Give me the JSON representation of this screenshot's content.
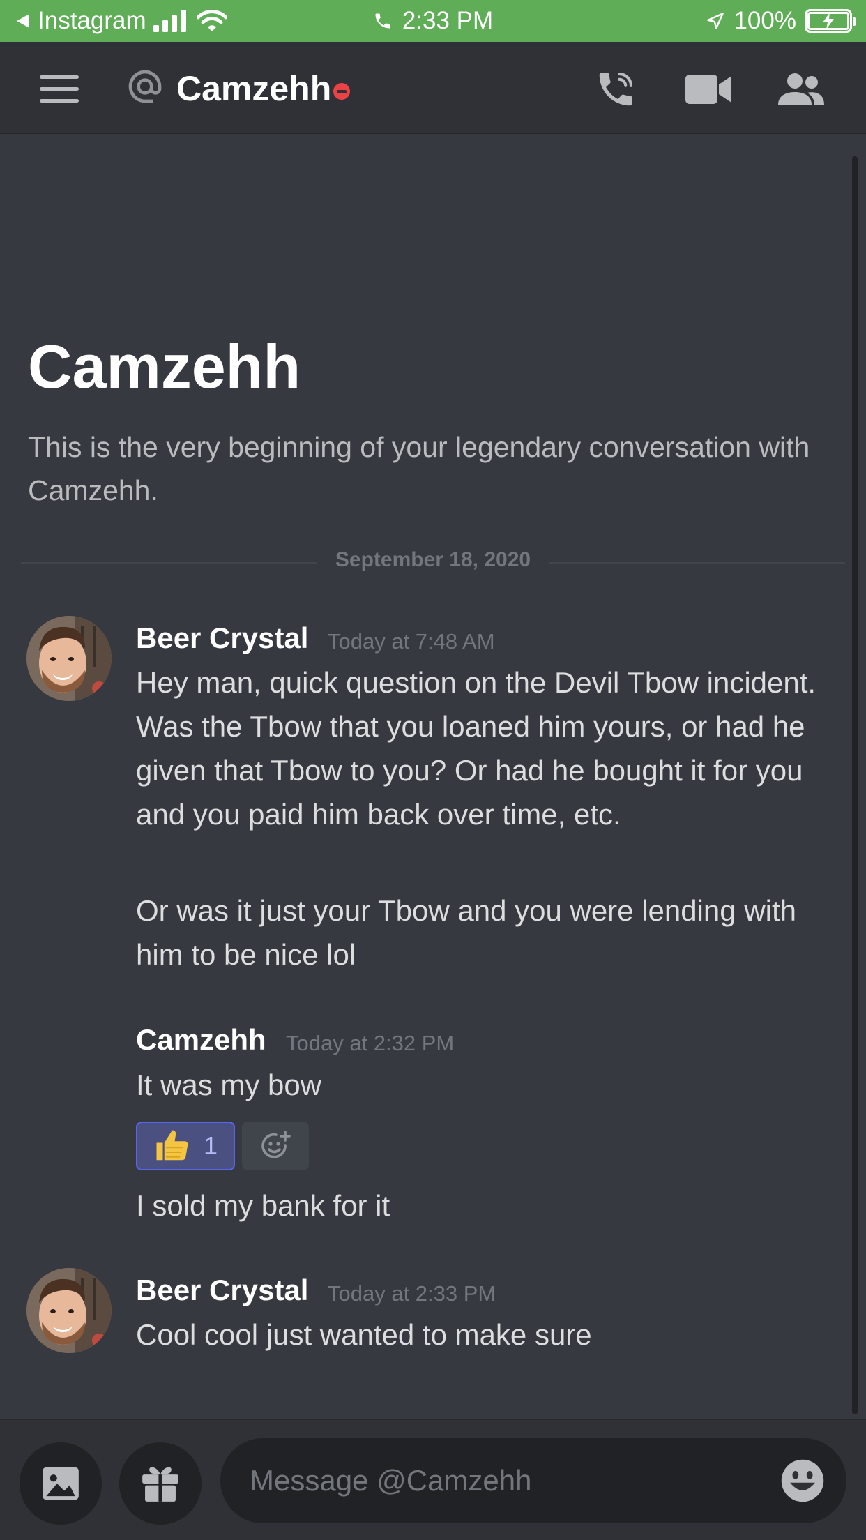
{
  "status_bar": {
    "back_app": "Instagram",
    "time": "2:33 PM",
    "battery": "100%"
  },
  "header": {
    "channel_name": "Camzehh",
    "icons": [
      "menu-icon",
      "at-icon",
      "call-icon",
      "video-icon",
      "members-icon"
    ]
  },
  "welcome": {
    "title": "Camzehh",
    "subtitle": "This is the very beginning of your legendary conversation with Camzehh."
  },
  "date_divider": "September 18, 2020",
  "messages": [
    {
      "author": "Beer Crystal",
      "time": "Today at 7:48 AM",
      "lines": [
        "Hey man, quick question on the Devil Tbow incident. Was the Tbow that you loaned him yours, or had he given that Tbow to you? Or had he bought it for you and you paid him back over time, etc.",
        "Or was it just your Tbow and you were lending with him to be nice lol"
      ]
    },
    {
      "author": "Camzehh",
      "time": "Today at 2:32 PM",
      "lines": [
        "It was my bow",
        "I sold my bank for it"
      ],
      "reaction": {
        "emoji": "👍",
        "count": "1"
      }
    },
    {
      "author": "Beer Crystal",
      "time": "Today at 2:33 PM",
      "lines": [
        "Cool cool just wanted to make sure"
      ]
    }
  ],
  "composer": {
    "placeholder": "Message @Camzehh"
  },
  "colors": {
    "status_bar": "#5fad56",
    "background": "#36393f",
    "header": "#2f3136",
    "accent": "#5865f2",
    "dnd": "#ed4245"
  }
}
